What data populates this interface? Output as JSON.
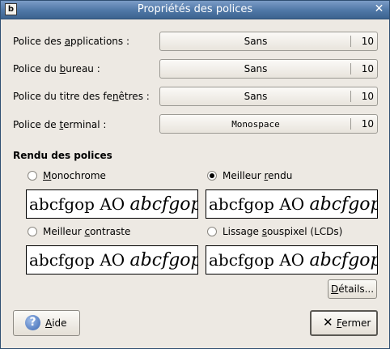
{
  "window": {
    "title": "Propriétés des polices"
  },
  "fonts": {
    "applications": {
      "label_pre": "Police des ",
      "label_mn": "a",
      "label_post": "pplications :",
      "name": "Sans",
      "size": "10"
    },
    "desktop": {
      "label_pre": "Police du ",
      "label_mn": "b",
      "label_post": "ureau :",
      "name": "Sans",
      "size": "10"
    },
    "window_title": {
      "label_pre": "Police du titre des fe",
      "label_mn": "n",
      "label_post": "êtres :",
      "name": "Sans",
      "size": "10"
    },
    "terminal": {
      "label_pre": "Police de ",
      "label_mn": "t",
      "label_post": "erminal :",
      "name": "Monospace",
      "size": "10"
    }
  },
  "rendering": {
    "title": "Rendu des polices",
    "preview_regular": "abcfgop AO ",
    "preview_italic": "abcfgop",
    "options": {
      "mono": {
        "pre": "",
        "mn": "M",
        "post": "onochrome",
        "checked": false
      },
      "best_shapes": {
        "pre": "Meilleur ",
        "mn": "r",
        "post": "endu",
        "checked": true
      },
      "best_contrast": {
        "pre": "Meilleur ",
        "mn": "c",
        "post": "ontraste",
        "checked": false
      },
      "subpixel": {
        "pre": "Lissage ",
        "mn": "s",
        "post": "ouspixel (LCDs)",
        "checked": false
      }
    }
  },
  "buttons": {
    "details_pre": "",
    "details_mn": "D",
    "details_post": "étails...",
    "help_pre": "",
    "help_mn": "A",
    "help_post": "ide",
    "close_pre": "",
    "close_mn": "F",
    "close_post": "ermer"
  },
  "icons": {
    "window": "app-window-icon",
    "close": "close-icon",
    "help": "help-icon",
    "fermer": "close-x-icon"
  }
}
